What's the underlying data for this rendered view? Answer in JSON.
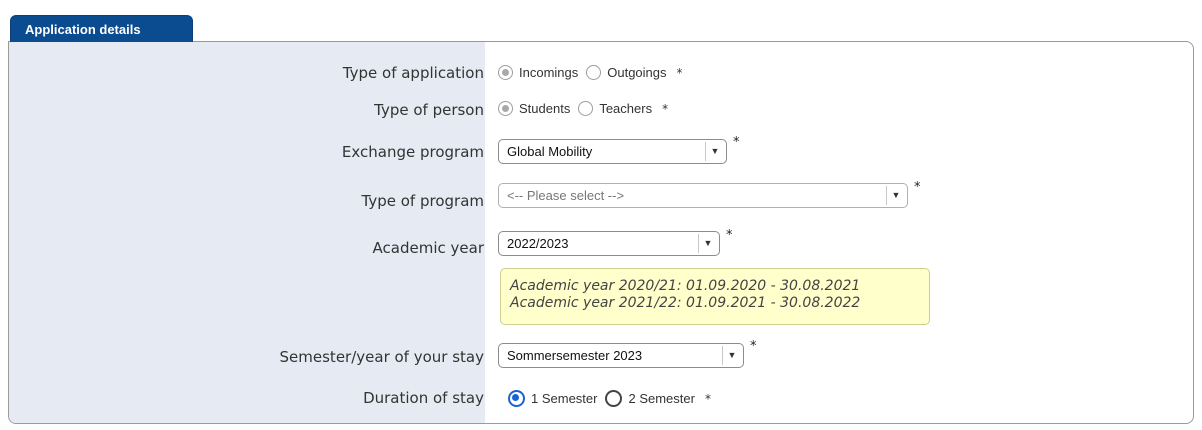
{
  "tab_title": "Application details",
  "fields": {
    "type_of_application": {
      "label": "Type of application",
      "options": [
        "Incomings",
        "Outgoings"
      ],
      "selected": "Incomings",
      "required": "*"
    },
    "type_of_person": {
      "label": "Type of person",
      "options": [
        "Students",
        "Teachers"
      ],
      "selected": "Students",
      "required": "*"
    },
    "exchange_program": {
      "label": "Exchange program",
      "value": "Global Mobility",
      "required": "*"
    },
    "type_of_program": {
      "label": "Type of program",
      "placeholder": "<-- Please select -->",
      "required": "*"
    },
    "academic_year": {
      "label": "Academic year",
      "value": "2022/2023",
      "required": "*"
    },
    "academic_year_note": {
      "line1": "Academic year 2020/21: 01.09.2020 - 30.08.2021",
      "line2": "Academic year 2021/22: 01.09.2021 - 30.08.2022"
    },
    "semester_of_stay": {
      "label": "Semester/year of your stay",
      "value": "Sommersemester 2023",
      "required": "*"
    },
    "duration_of_stay": {
      "label": "Duration of stay",
      "options": [
        "1 Semester",
        "2 Semester"
      ],
      "selected": "1 Semester",
      "required": "*"
    }
  },
  "colors": {
    "tab_bg": "#0b4b8f",
    "label_column_bg": "#e6ebf3",
    "note_bg": "#ffffcc",
    "radio_active": "#1a63d6"
  },
  "icons": {
    "dropdown": "chevron-down-icon"
  }
}
